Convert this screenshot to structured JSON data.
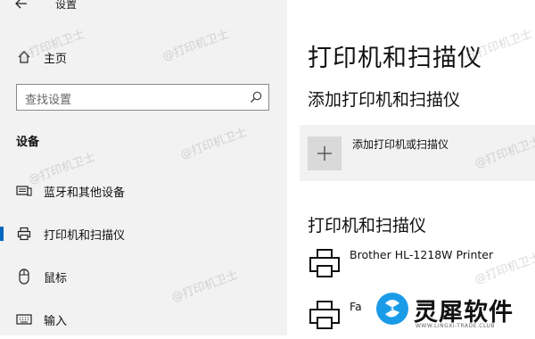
{
  "window": {
    "title": "设置"
  },
  "sidebar": {
    "home_label": "主页",
    "search": {
      "placeholder": "查找设置"
    },
    "section_title": "设备",
    "items": [
      {
        "label": "蓝牙和其他设备",
        "icon": "bluetooth-devices-icon",
        "selected": false
      },
      {
        "label": "打印机和扫描仪",
        "icon": "printer-icon",
        "selected": true
      },
      {
        "label": "鼠标",
        "icon": "mouse-icon",
        "selected": false
      },
      {
        "label": "输入",
        "icon": "keyboard-icon",
        "selected": false
      }
    ]
  },
  "main": {
    "title": "打印机和扫描仪",
    "add_section_title": "添加打印机和扫描仪",
    "add_button_label": "添加打印机或扫描仪",
    "list_title": "打印机和扫描仪",
    "printers": [
      {
        "name": "Brother HL-1218W Printer"
      },
      {
        "name": "Fa"
      }
    ]
  },
  "watermark": {
    "text": "@打印机卫士"
  },
  "logo": {
    "brand": "灵犀软件",
    "sub": "WWW.LINGXI-TRADE.CLUB"
  },
  "colors": {
    "accent": "#0067c0",
    "sidebar_bg": "#f2f2f2",
    "tile_bg": "#f2f2f2"
  }
}
